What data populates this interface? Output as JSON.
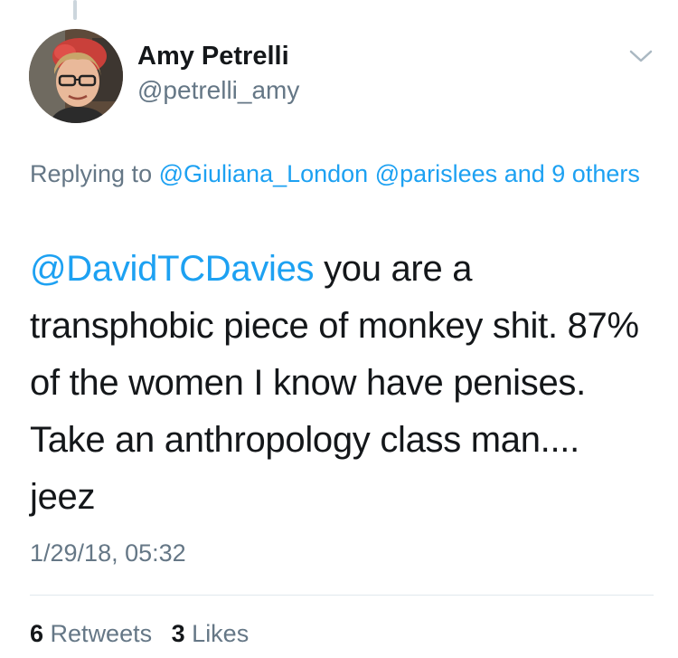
{
  "author": {
    "display_name": "Amy Petrelli",
    "handle": "@petrelli_amy"
  },
  "reply": {
    "prefix": "Replying to",
    "mention_1": "@Giuliana_London",
    "mention_2": "@parislees",
    "conjunction": "and",
    "others": "9 others"
  },
  "tweet": {
    "mention": "@DavidTCDavies",
    "body": " you are a transphobic piece of monkey shit. 87% of the women I know have penises. Take an anthropology class man.... jeez"
  },
  "timestamp": "1/29/18, 05:32",
  "stats": {
    "retweets_count": "6",
    "retweets_label": "Retweets",
    "likes_count": "3",
    "likes_label": "Likes"
  },
  "colors": {
    "link": "#1da1f2",
    "secondary_text": "#657786",
    "primary_text": "#14171a"
  },
  "icons": {
    "caret": "chevron-down-icon"
  }
}
